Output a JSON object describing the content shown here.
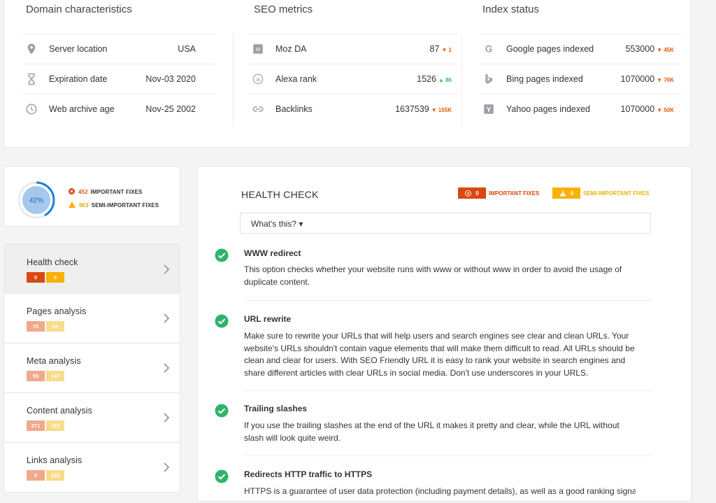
{
  "top": {
    "domain": {
      "title": "Domain characteristics",
      "rows": [
        {
          "icon": "location-pin-icon",
          "label": "Server location",
          "value": "USA"
        },
        {
          "icon": "hourglass-icon",
          "label": "Expiration date",
          "value": "Nov-03 2020"
        },
        {
          "icon": "clock-icon",
          "label": "Web archive age",
          "value": "Nov-25 2002"
        }
      ]
    },
    "seo": {
      "title": "SEO metrics",
      "rows": [
        {
          "icon": "moz-icon",
          "label": "Moz DA",
          "value": "87",
          "change": "1",
          "dir": "down"
        },
        {
          "icon": "alexa-icon",
          "label": "Alexa rank",
          "value": "1526",
          "change": "86",
          "dir": "up"
        },
        {
          "icon": "link-icon",
          "label": "Backlinks",
          "value": "1637539",
          "change": "155K",
          "dir": "down"
        }
      ]
    },
    "index": {
      "title": "Index status",
      "rows": [
        {
          "icon": "google-icon",
          "label": "Google pages indexed",
          "value": "553000",
          "change": "45K",
          "dir": "down"
        },
        {
          "icon": "bing-icon",
          "label": "Bing pages indexed",
          "value": "1070000",
          "change": "70K",
          "dir": "down"
        },
        {
          "icon": "yahoo-icon",
          "label": "Yahoo pages indexed",
          "value": "1070000",
          "change": "50K",
          "dir": "down"
        }
      ]
    }
  },
  "summary": {
    "score": "42%",
    "score_fraction": 0.42,
    "important_count": "452",
    "important_label": "IMPORTANT FIXES",
    "semi_count": "963",
    "semi_label": "SEMI-IMPORTANT FIXES"
  },
  "nav": [
    {
      "label": "Health check",
      "a": "0",
      "b": "0",
      "active": true
    },
    {
      "label": "Pages analysis",
      "a": "70",
      "b": "44",
      "active": false
    },
    {
      "label": "Meta analysis",
      "a": "95",
      "b": "147",
      "active": false
    },
    {
      "label": "Content analysis",
      "a": "271",
      "b": "193",
      "active": false
    },
    {
      "label": "Links analysis",
      "a": "0",
      "b": "233",
      "active": false
    }
  ],
  "main": {
    "title": "HEALTH CHECK",
    "important_count": "0",
    "important_label": "IMPORTANT FIXES",
    "semi_count": "0",
    "semi_label": "SEMI-IMPORTANT FIXES",
    "whats_this": "What's this? ▾",
    "items": [
      {
        "title": "WWW redirect",
        "desc": "This option checks whether your website runs with www or without www in order to avoid the usage of duplicate content."
      },
      {
        "title": "URL rewrite",
        "desc": "Make sure to rewrite your URLs that will help users and search engines see clear and clean URLs. Your website's URLs shouldn't contain vague elements that will make them difficult to read. All URLs should be clean and clear for users. With SEO Friendly URL it is easy to rank your website in search engines and share different articles with clear URLs in social media. Don't use underscores in your URLS."
      },
      {
        "title": "Trailing slashes",
        "desc": "If you use the trailing slashes at the end of the URL it makes it pretty and clear, while the URL without slash will look quite weird."
      },
      {
        "title": "Redirects HTTP traffic to HTTPS",
        "desc": "HTTPS is a guarantee of user data protection (including payment details), as well as a good ranking signal for"
      }
    ]
  },
  "colors": {
    "important": "#d9480f",
    "semi": "#fab005",
    "check": "#2fb36b",
    "donut": "#1c7ed6",
    "donut_fill": "#a5c8ef"
  }
}
